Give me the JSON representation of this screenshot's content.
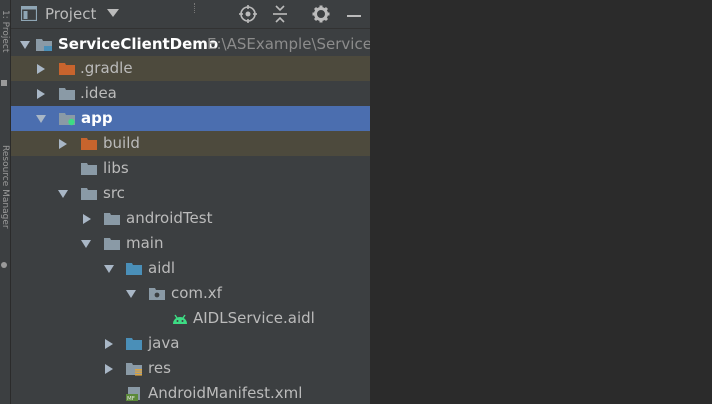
{
  "side_tabs": {
    "top_label": "1: Project",
    "bottom_label": "Resource Manager"
  },
  "header": {
    "title": "Project",
    "buttons": [
      "locate-icon",
      "collapse-all-icon",
      "gear-icon",
      "hide-icon"
    ]
  },
  "tree": [
    {
      "label": "ServiceClientDemo",
      "path": "E:\\ASExample\\ServiceC",
      "icon": "module-folder-icon",
      "expanded": true
    },
    {
      "label": ".gradle",
      "icon": "excluded-folder-icon",
      "expanded": false
    },
    {
      "label": ".idea",
      "icon": "folder-icon",
      "expanded": false
    },
    {
      "label": "app",
      "icon": "android-module-folder-icon",
      "expanded": true,
      "selected": true
    },
    {
      "label": "build",
      "icon": "excluded-folder-icon",
      "expanded": false
    },
    {
      "label": "libs",
      "icon": "folder-icon"
    },
    {
      "label": "src",
      "icon": "folder-icon",
      "expanded": true
    },
    {
      "label": "androidTest",
      "icon": "folder-icon",
      "expanded": false
    },
    {
      "label": "main",
      "icon": "folder-icon",
      "expanded": true
    },
    {
      "label": "aidl",
      "icon": "source-folder-icon",
      "expanded": true
    },
    {
      "label": "com.xf",
      "icon": "package-icon",
      "expanded": true
    },
    {
      "label": "AIDLService.aidl",
      "icon": "android-icon"
    },
    {
      "label": "java",
      "icon": "source-folder-icon",
      "expanded": false
    },
    {
      "label": "res",
      "icon": "resources-folder-icon",
      "expanded": false
    },
    {
      "label": "AndroidManifest.xml",
      "icon": "manifest-icon"
    }
  ],
  "colors": {
    "panel_bg": "#3c3f41",
    "editor_bg": "#2b2b2b",
    "selection": "#4b6eaf",
    "excluded_highlight": "#4d4a3d",
    "excluded_folder": "#c8642d",
    "plain_folder": "#8a9aa6",
    "source_folder": "#4a8fb8",
    "android_green": "#3ddc84"
  }
}
